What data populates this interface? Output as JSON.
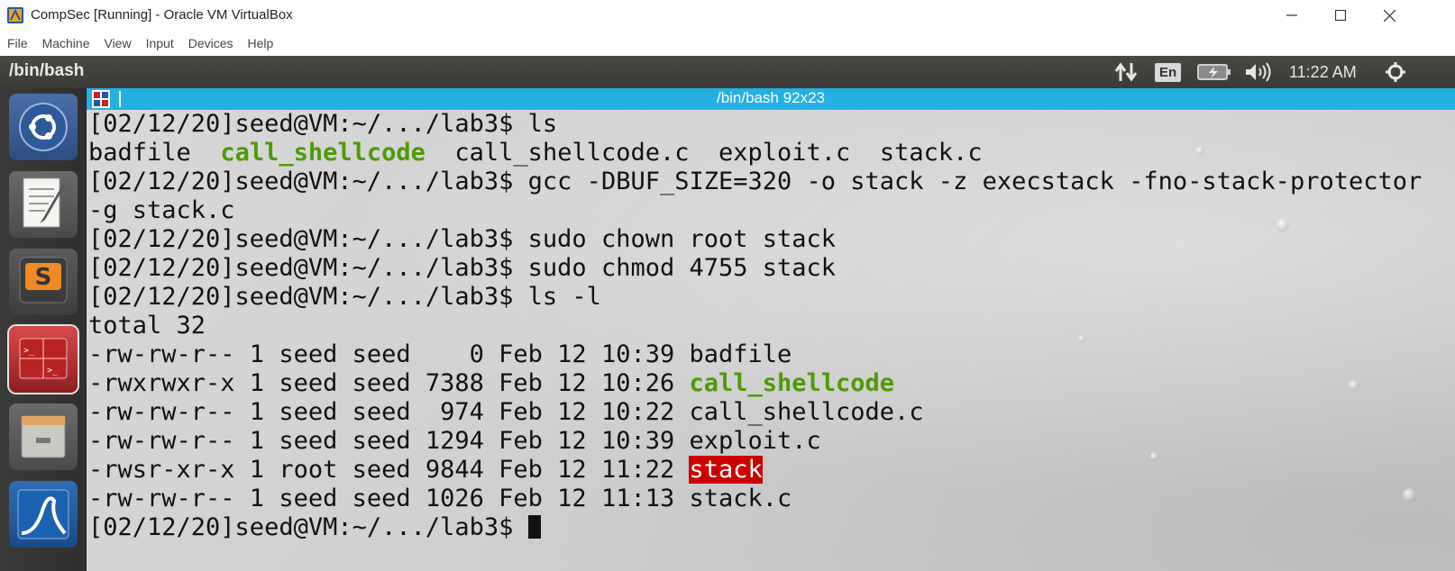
{
  "window": {
    "title": "CompSec [Running] - Oracle VM VirtualBox"
  },
  "vbox_menu": [
    "File",
    "Machine",
    "View",
    "Input",
    "Devices",
    "Help"
  ],
  "top_panel": {
    "title": "/bin/bash",
    "language": "En",
    "clock": "11:22 AM"
  },
  "launcher": {
    "apps": [
      "ubuntu-dash-icon",
      "text-editor-icon",
      "sublime-text-icon",
      "terminal-icon",
      "files-icon",
      "wireshark-icon"
    ]
  },
  "terminal": {
    "title": "/bin/bash 92x23",
    "lines": [
      "[02/12/20]seed@VM:~/.../lab3$ ls",
      "[02/12/20]seed@VM:~/.../lab3$ gcc -DBUF_SIZE=320 -o stack -z execstack -fno-stack-protector",
      "-g stack.c",
      "[02/12/20]seed@VM:~/.../lab3$ sudo chown root stack",
      "[02/12/20]seed@VM:~/.../lab3$ sudo chmod 4755 stack",
      "[02/12/20]seed@VM:~/.../lab3$ ls -l",
      "total 32",
      "[02/12/20]seed@VM:~/.../lab3$ "
    ],
    "ls_output": {
      "f1": "badfile",
      "f2": "call_shellcode",
      "f3": "call_shellcode.c",
      "f4": "exploit.c",
      "f5": "stack.c"
    },
    "listing": [
      {
        "meta": "-rw-rw-r-- 1 seed seed    0 Feb 12 10:39 ",
        "name": "badfile"
      },
      {
        "meta": "-rwxrwxr-x 1 seed seed 7388 Feb 12 10:26 ",
        "name": "call_shellcode"
      },
      {
        "meta": "-rw-rw-r-- 1 seed seed  974 Feb 12 10:22 ",
        "name": "call_shellcode.c"
      },
      {
        "meta": "-rw-rw-r-- 1 seed seed 1294 Feb 12 10:39 ",
        "name": "exploit.c"
      },
      {
        "meta": "-rwsr-xr-x 1 root seed 9844 Feb 12 11:22 ",
        "name": "stack"
      },
      {
        "meta": "-rw-rw-r-- 1 seed seed 1026 Feb 12 11:13 ",
        "name": "stack.c"
      }
    ],
    "colors": {
      "executable": "#4e9a06",
      "setuid_bg": "#cc0000",
      "title_bar": "#25b0e4"
    }
  }
}
